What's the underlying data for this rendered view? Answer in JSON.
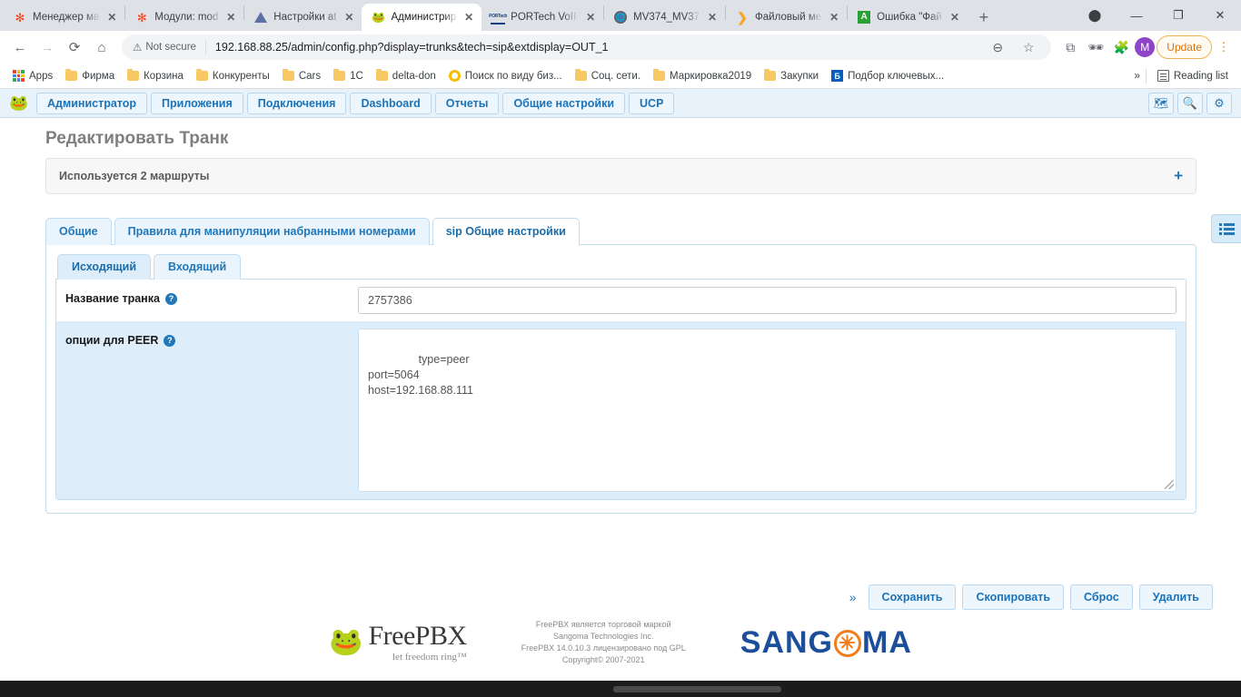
{
  "browser": {
    "tabs": [
      {
        "title": "Менеджер ма",
        "icon": "joomla-icon",
        "active": false
      },
      {
        "title": "Модули: mod",
        "icon": "joomla-icon",
        "active": false
      },
      {
        "title": "Настройки at",
        "icon": "triangle-icon",
        "active": false
      },
      {
        "title": "Администрир",
        "icon": "freepbx-frog-icon",
        "active": true
      },
      {
        "title": "PORTech VoIP",
        "icon": "portech-icon",
        "active": false
      },
      {
        "title": "MV374_MV37",
        "icon": "globe-icon",
        "active": false
      },
      {
        "title": "Файловый ме",
        "icon": "chevron-icon",
        "active": false
      },
      {
        "title": "Ошибка \"Фай",
        "icon": "letter-a-icon",
        "active": false
      }
    ],
    "new_tab_label": "+",
    "window_controls": {
      "minimize": "—",
      "maximize": "❐",
      "close": "✕"
    },
    "omnibox": {
      "security_label": "Not secure",
      "url": "192.168.88.25/admin/config.php?display=trunks&tech=sip&extdisplay=OUT_1"
    },
    "toolbar_icons": [
      "zoom-out-icon",
      "bookmark-star-icon",
      "screen-cast-icon",
      "incognito-icon",
      "extensions-icon"
    ],
    "profile_initial": "M",
    "update_button": "Update",
    "kebab_menu": "⋮",
    "bookmarks": [
      {
        "label": "Apps",
        "icon": "apps-grid-icon"
      },
      {
        "label": "Фирма",
        "icon": "folder-icon"
      },
      {
        "label": "Корзина",
        "icon": "folder-icon"
      },
      {
        "label": "Конкуренты",
        "icon": "folder-icon"
      },
      {
        "label": "Cars",
        "icon": "folder-icon"
      },
      {
        "label": "1C",
        "icon": "folder-icon"
      },
      {
        "label": "delta-don",
        "icon": "folder-icon"
      },
      {
        "label": "Поиск по виду биз...",
        "icon": "ring-icon"
      },
      {
        "label": "Соц. сети.",
        "icon": "folder-icon"
      },
      {
        "label": "Маркировка2019",
        "icon": "folder-icon"
      },
      {
        "label": "Закупки",
        "icon": "folder-icon"
      },
      {
        "label": "Подбор ключевых...",
        "icon": "bitrix-icon"
      }
    ],
    "bookmarks_overflow": "»",
    "reading_list": "Reading list"
  },
  "app": {
    "nav": [
      {
        "label": "Администратор"
      },
      {
        "label": "Приложения"
      },
      {
        "label": "Подключения"
      },
      {
        "label": "Dashboard"
      },
      {
        "label": "Отчеты"
      },
      {
        "label": "Общие настройки"
      },
      {
        "label": "UCP"
      }
    ],
    "nav_icons": [
      "translate-icon",
      "search-icon",
      "gear-icon"
    ],
    "page_title": "Редактировать Транк",
    "notice": {
      "text": "Используется 2 маршруты",
      "expand": "+"
    },
    "tabs": [
      {
        "label": "Общие",
        "active": false
      },
      {
        "label": "Правила для манипуляции набранными номерами",
        "active": false
      },
      {
        "label": "sip Общие настройки",
        "active": true
      }
    ],
    "sub_tabs": [
      {
        "label": "Исходящий",
        "active": true
      },
      {
        "label": "Входящий",
        "active": false
      }
    ],
    "form": {
      "trunk_name": {
        "label": "Название транка",
        "value": "2757386",
        "help": "?"
      },
      "peer_options": {
        "label": "опции для PEER",
        "value": "type=peer\nport=5064\nhost=192.168.88.111",
        "help": "?"
      }
    },
    "actions": {
      "expander": "»",
      "buttons": [
        {
          "label": "Сохранить"
        },
        {
          "label": "Скопировать"
        },
        {
          "label": "Сброс"
        },
        {
          "label": "Удалить"
        }
      ]
    },
    "side_panel_icon": "list-icon",
    "footer": {
      "brand_name": "FreePBX",
      "brand_tagline": "let freedom ring™",
      "copyright": "FreePBX является торговой маркой\nSangoma Technologies Inc.\nFreePBX 14.0.10.3 лицензировано под GPL\nCopyright© 2007-2021",
      "sangoma_left": "SANG",
      "sangoma_star": "✳",
      "sangoma_right": "MA"
    }
  },
  "colors": {
    "accent": "#2178b9",
    "nav_bg": "#e8f2fb",
    "update_orange": "#d9750b",
    "sangoma_blue": "#1b4f9c",
    "sangoma_orange": "#f07d1a"
  }
}
